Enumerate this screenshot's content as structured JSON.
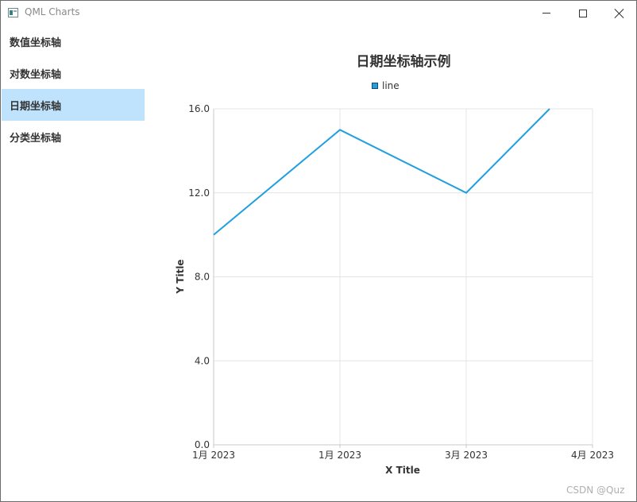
{
  "window": {
    "title": "QML Charts"
  },
  "sidebar": {
    "items": [
      {
        "label": "数值坐标轴",
        "active": false
      },
      {
        "label": "对数坐标轴",
        "active": false
      },
      {
        "label": "日期坐标轴",
        "active": true
      },
      {
        "label": "分类坐标轴",
        "active": false
      }
    ]
  },
  "colors": {
    "series": "#209fdf",
    "active_nav": "#bfe3fd",
    "grid": "#e4e4e4"
  },
  "chart_data": {
    "type": "line",
    "title": "日期坐标轴示例",
    "xlabel": "X Title",
    "ylabel": "Y Title",
    "ylim": [
      0,
      16
    ],
    "y_ticks": [
      "0.0",
      "4.0",
      "8.0",
      "12.0",
      "16.0"
    ],
    "x_tick_labels": [
      "1月 2023",
      "1月 2023",
      "3月 2023",
      "4月 2023"
    ],
    "grid": true,
    "legend_position": "top",
    "series": [
      {
        "name": "line",
        "x": [
          "2023-01-01",
          "2023-01-31",
          "2023-03-02",
          "2023-03-22"
        ],
        "values": [
          10,
          15,
          12,
          16
        ]
      }
    ]
  },
  "watermark": "CSDN @Quz"
}
